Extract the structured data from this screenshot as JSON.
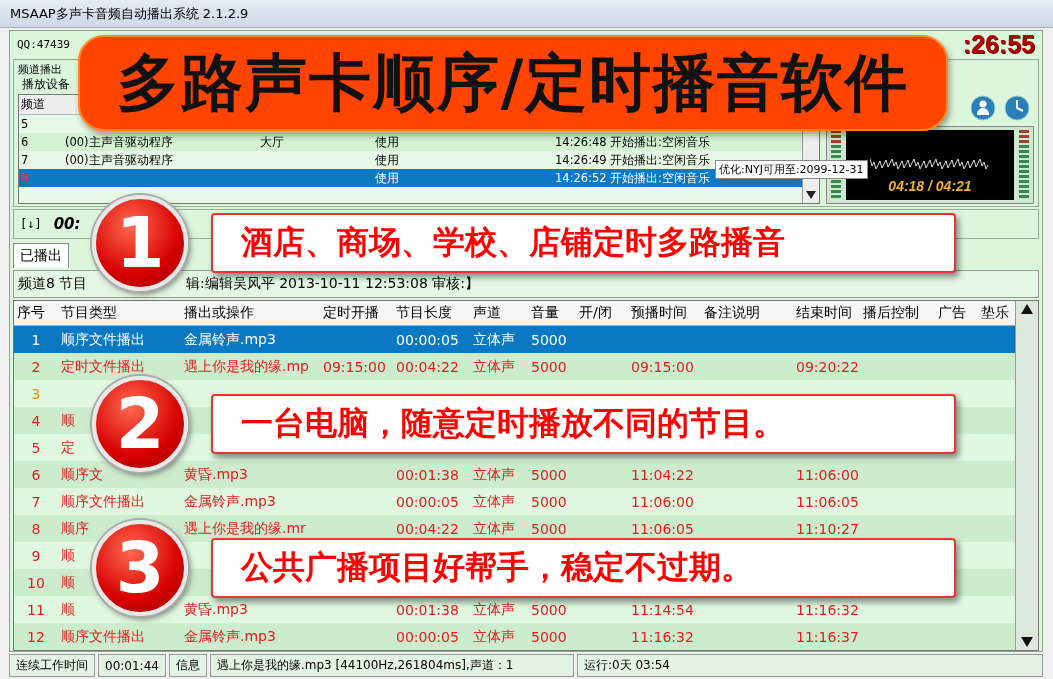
{
  "window": {
    "title": "MSAAP多声卡音频自动播出系统 2.1.2.9"
  },
  "header": {
    "contact": "QQ:47439",
    "clock": ":26:55"
  },
  "channel_panel": {
    "group_title": "频道播出",
    "device_label": "播放设备",
    "columns": [
      "频道"
    ],
    "rows": [
      {
        "channel": "5",
        "selected": false
      },
      {
        "channel": "6",
        "device": "(00)主声音驱动程序",
        "location": "大厅",
        "status": "使用",
        "time": "14:26:48",
        "event": "开始播出:空闲音乐",
        "selected": false
      },
      {
        "channel": "7",
        "device": "(00)主声音驱动程序",
        "status": "使用",
        "time": "14:26:49",
        "event": "开始播出:空闲音乐",
        "selected": false
      },
      {
        "channel": "8",
        "status": "使用",
        "time": "14:26:52",
        "event": "开始播出:空闲音乐",
        "selected": true,
        "color": "#ff3030"
      }
    ],
    "transport": {
      "marker": "[↓]",
      "elapsed": "00:"
    },
    "player": {
      "progress": "04:18 / 04:21",
      "tooltip": "优化:NYJ可用至:2099-12-31"
    }
  },
  "tabs": [
    {
      "label": "已播出",
      "selected": true
    }
  ],
  "program_info": {
    "left": "频道8 节目",
    "right": "辑:编辑吴风平 2013-10-11 12:53:08  审核:】"
  },
  "program_table": {
    "columns": [
      "序号",
      "节目类型",
      "播出或操作",
      "定时开播",
      "节目长度",
      "声道",
      "音量",
      "开/闭",
      "预播时间",
      "备注说明",
      "结束时间",
      "播后控制",
      "广告",
      "垫乐"
    ],
    "rows": [
      {
        "no": "1",
        "type": "顺序文件播出",
        "item": "金属铃声.mp3",
        "length": "00:00:05",
        "channel": "立体声",
        "volume": "5000",
        "selected": true
      },
      {
        "no": "2",
        "type": "定时文件播出",
        "item": "遇上你是我的缘.mp",
        "start": "09:15:00",
        "length": "00:04:22",
        "channel": "立体声",
        "volume": "5000",
        "preplay": "09:15:00",
        "end": "09:20:22",
        "selected": false,
        "color": "#e02020"
      },
      {
        "no": "3",
        "selected": false,
        "color": "#e89000"
      },
      {
        "no": "4",
        "type": "顺",
        "selected": false,
        "color": "#e02020"
      },
      {
        "no": "5",
        "type": "定",
        "selected": false,
        "color": "#e02020"
      },
      {
        "no": "6",
        "type": "顺序文",
        "item": "黄昏.mp3",
        "length": "00:01:38",
        "channel": "立体声",
        "volume": "5000",
        "preplay": "11:04:22",
        "end": "11:06:00",
        "selected": false,
        "color": "#e02020"
      },
      {
        "no": "7",
        "type": "顺序文件播出",
        "item": "金属铃声.mp3",
        "length": "00:00:05",
        "channel": "立体声",
        "volume": "5000",
        "preplay": "11:06:00",
        "end": "11:06:05",
        "selected": false,
        "color": "#e02020"
      },
      {
        "no": "8",
        "type": "顺序",
        "item": "遇上你是我的缘.mr",
        "length": "00:04:22",
        "channel": "立体声",
        "volume": "5000",
        "preplay": "11:06:05",
        "end": "11:10:27",
        "selected": false,
        "color": "#e02020"
      },
      {
        "no": "9",
        "type": "顺",
        "selected": false,
        "color": "#e02020"
      },
      {
        "no": "10",
        "type": "顺",
        "selected": false,
        "color": "#e02020"
      },
      {
        "no": "11",
        "type": "顺",
        "item": "黄昏.mp3",
        "length": "00:01:38",
        "channel": "立体声",
        "volume": "5000",
        "preplay": "11:14:54",
        "end": "11:16:32",
        "selected": false,
        "color": "#e02020"
      },
      {
        "no": "12",
        "type": "顺序文件播出",
        "item": "金属铃声.mp3",
        "length": "00:00:05",
        "channel": "立体声",
        "volume": "5000",
        "preplay": "11:16:32",
        "end": "11:16:37",
        "selected": false,
        "color": "#e02020"
      }
    ]
  },
  "status_bar": [
    "连续工作时间",
    "00:01:44",
    "信息",
    "遇上你是我的缘.mp3 [44100Hz,261804ms],声道：1",
    "运行:0天 03:54"
  ],
  "promo": {
    "headline": "多路声卡顺序/定时播音软件",
    "callouts": [
      {
        "number": "1",
        "text": "酒店、商场、学校、店铺定时多路播音"
      },
      {
        "number": "2",
        "text": "一台电脑，随意定时播放不同的节目。"
      },
      {
        "number": "3",
        "text": "公共广播项目好帮手，稳定不过期。"
      }
    ]
  }
}
